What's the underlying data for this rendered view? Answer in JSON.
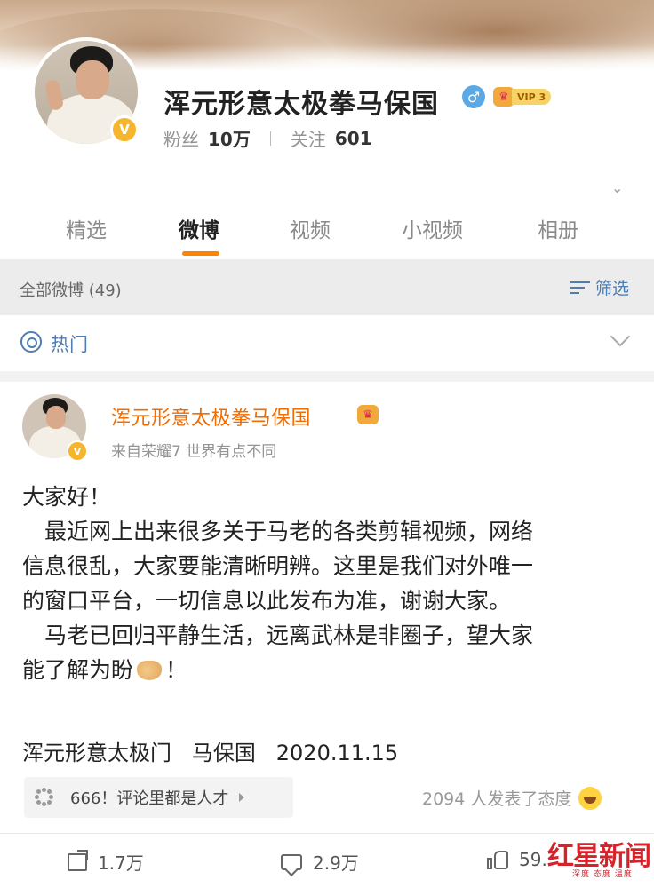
{
  "profile": {
    "name": "浑元形意太极拳马保国",
    "gender_symbol": "♂",
    "vip_label": "VIP 3",
    "verified_symbol": "V",
    "fans_label": "粉丝",
    "fans_value": "10万",
    "follow_label": "关注",
    "follow_value": "601"
  },
  "tabs": [
    {
      "label": "精选",
      "active": false
    },
    {
      "label": "微博",
      "active": true
    },
    {
      "label": "视频",
      "active": false
    },
    {
      "label": "小视频",
      "active": false
    },
    {
      "label": "相册",
      "active": false
    }
  ],
  "filter": {
    "title": "全部微博 (49)",
    "button_label": "筛选"
  },
  "hot": {
    "label": "热门"
  },
  "post": {
    "author": "浑元形意太极拳马保国",
    "source": "来自荣耀7 世界有点不同",
    "greeting": "大家好！",
    "lines": [
      "　最近网上出来很多关于马老的各类剪辑视频，网络",
      "信息很乱，大家要能清晰明辨。这里是我们对外唯一",
      "的窗口平台，一切信息以此发布为准，谢谢大家。",
      "　马老已回归平静生活，远离武林是非圈子，望大家"
    ],
    "last_line_text": "能了解为盼",
    "last_line_end": "！",
    "signature": "浑元形意太极门   马保国   2020.11.15",
    "topic": "666！评论里都是人才",
    "attitude": "2094 人发表了态度",
    "reposts": "1.7万",
    "comments": "2.9万",
    "likes": "59."
  },
  "watermark": {
    "text": "红星新闻",
    "sub": "深度 态度 温度"
  },
  "colors": {
    "accent": "#ff8200",
    "link_blue": "#507daf",
    "author_orange": "#f06b00"
  }
}
